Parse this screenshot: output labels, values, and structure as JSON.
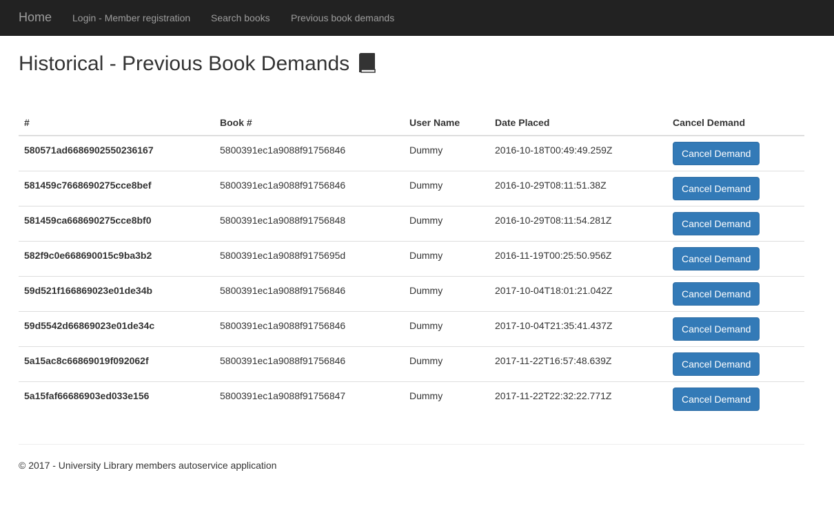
{
  "nav": {
    "brand": "Home",
    "links": [
      "Login - Member registration",
      "Search books",
      "Previous book demands"
    ]
  },
  "page": {
    "title": "Historical - Previous Book Demands",
    "title_icon": "book-icon"
  },
  "table": {
    "headers": [
      "#",
      "Book #",
      "User Name",
      "Date Placed",
      "Cancel Demand"
    ],
    "rows": [
      {
        "id": "580571ad6686902550236167",
        "book": "5800391ec1a9088f91756846",
        "user": "Dummy",
        "date": "2016-10-18T00:49:49.259Z",
        "action": "Cancel Demand"
      },
      {
        "id": "581459c7668690275cce8bef",
        "book": "5800391ec1a9088f91756846",
        "user": "Dummy",
        "date": "2016-10-29T08:11:51.38Z",
        "action": "Cancel Demand"
      },
      {
        "id": "581459ca668690275cce8bf0",
        "book": "5800391ec1a9088f91756848",
        "user": "Dummy",
        "date": "2016-10-29T08:11:54.281Z",
        "action": "Cancel Demand"
      },
      {
        "id": "582f9c0e668690015c9ba3b2",
        "book": "5800391ec1a9088f9175695d",
        "user": "Dummy",
        "date": "2016-11-19T00:25:50.956Z",
        "action": "Cancel Demand"
      },
      {
        "id": "59d521f166869023e01de34b",
        "book": "5800391ec1a9088f91756846",
        "user": "Dummy",
        "date": "2017-10-04T18:01:21.042Z",
        "action": "Cancel Demand"
      },
      {
        "id": "59d5542d66869023e01de34c",
        "book": "5800391ec1a9088f91756846",
        "user": "Dummy",
        "date": "2017-10-04T21:35:41.437Z",
        "action": "Cancel Demand"
      },
      {
        "id": "5a15ac8c66869019f092062f",
        "book": "5800391ec1a9088f91756846",
        "user": "Dummy",
        "date": "2017-11-22T16:57:48.639Z",
        "action": "Cancel Demand"
      },
      {
        "id": "5a15faf66686903ed033e156",
        "book": "5800391ec1a9088f91756847",
        "user": "Dummy",
        "date": "2017-11-22T22:32:22.771Z",
        "action": "Cancel Demand"
      }
    ]
  },
  "footer": {
    "text": "© 2017 - University Library members autoservice application"
  },
  "colors": {
    "navbar_bg": "#222222",
    "nav_text": "#9d9d9d",
    "button_primary": "#337ab7"
  }
}
